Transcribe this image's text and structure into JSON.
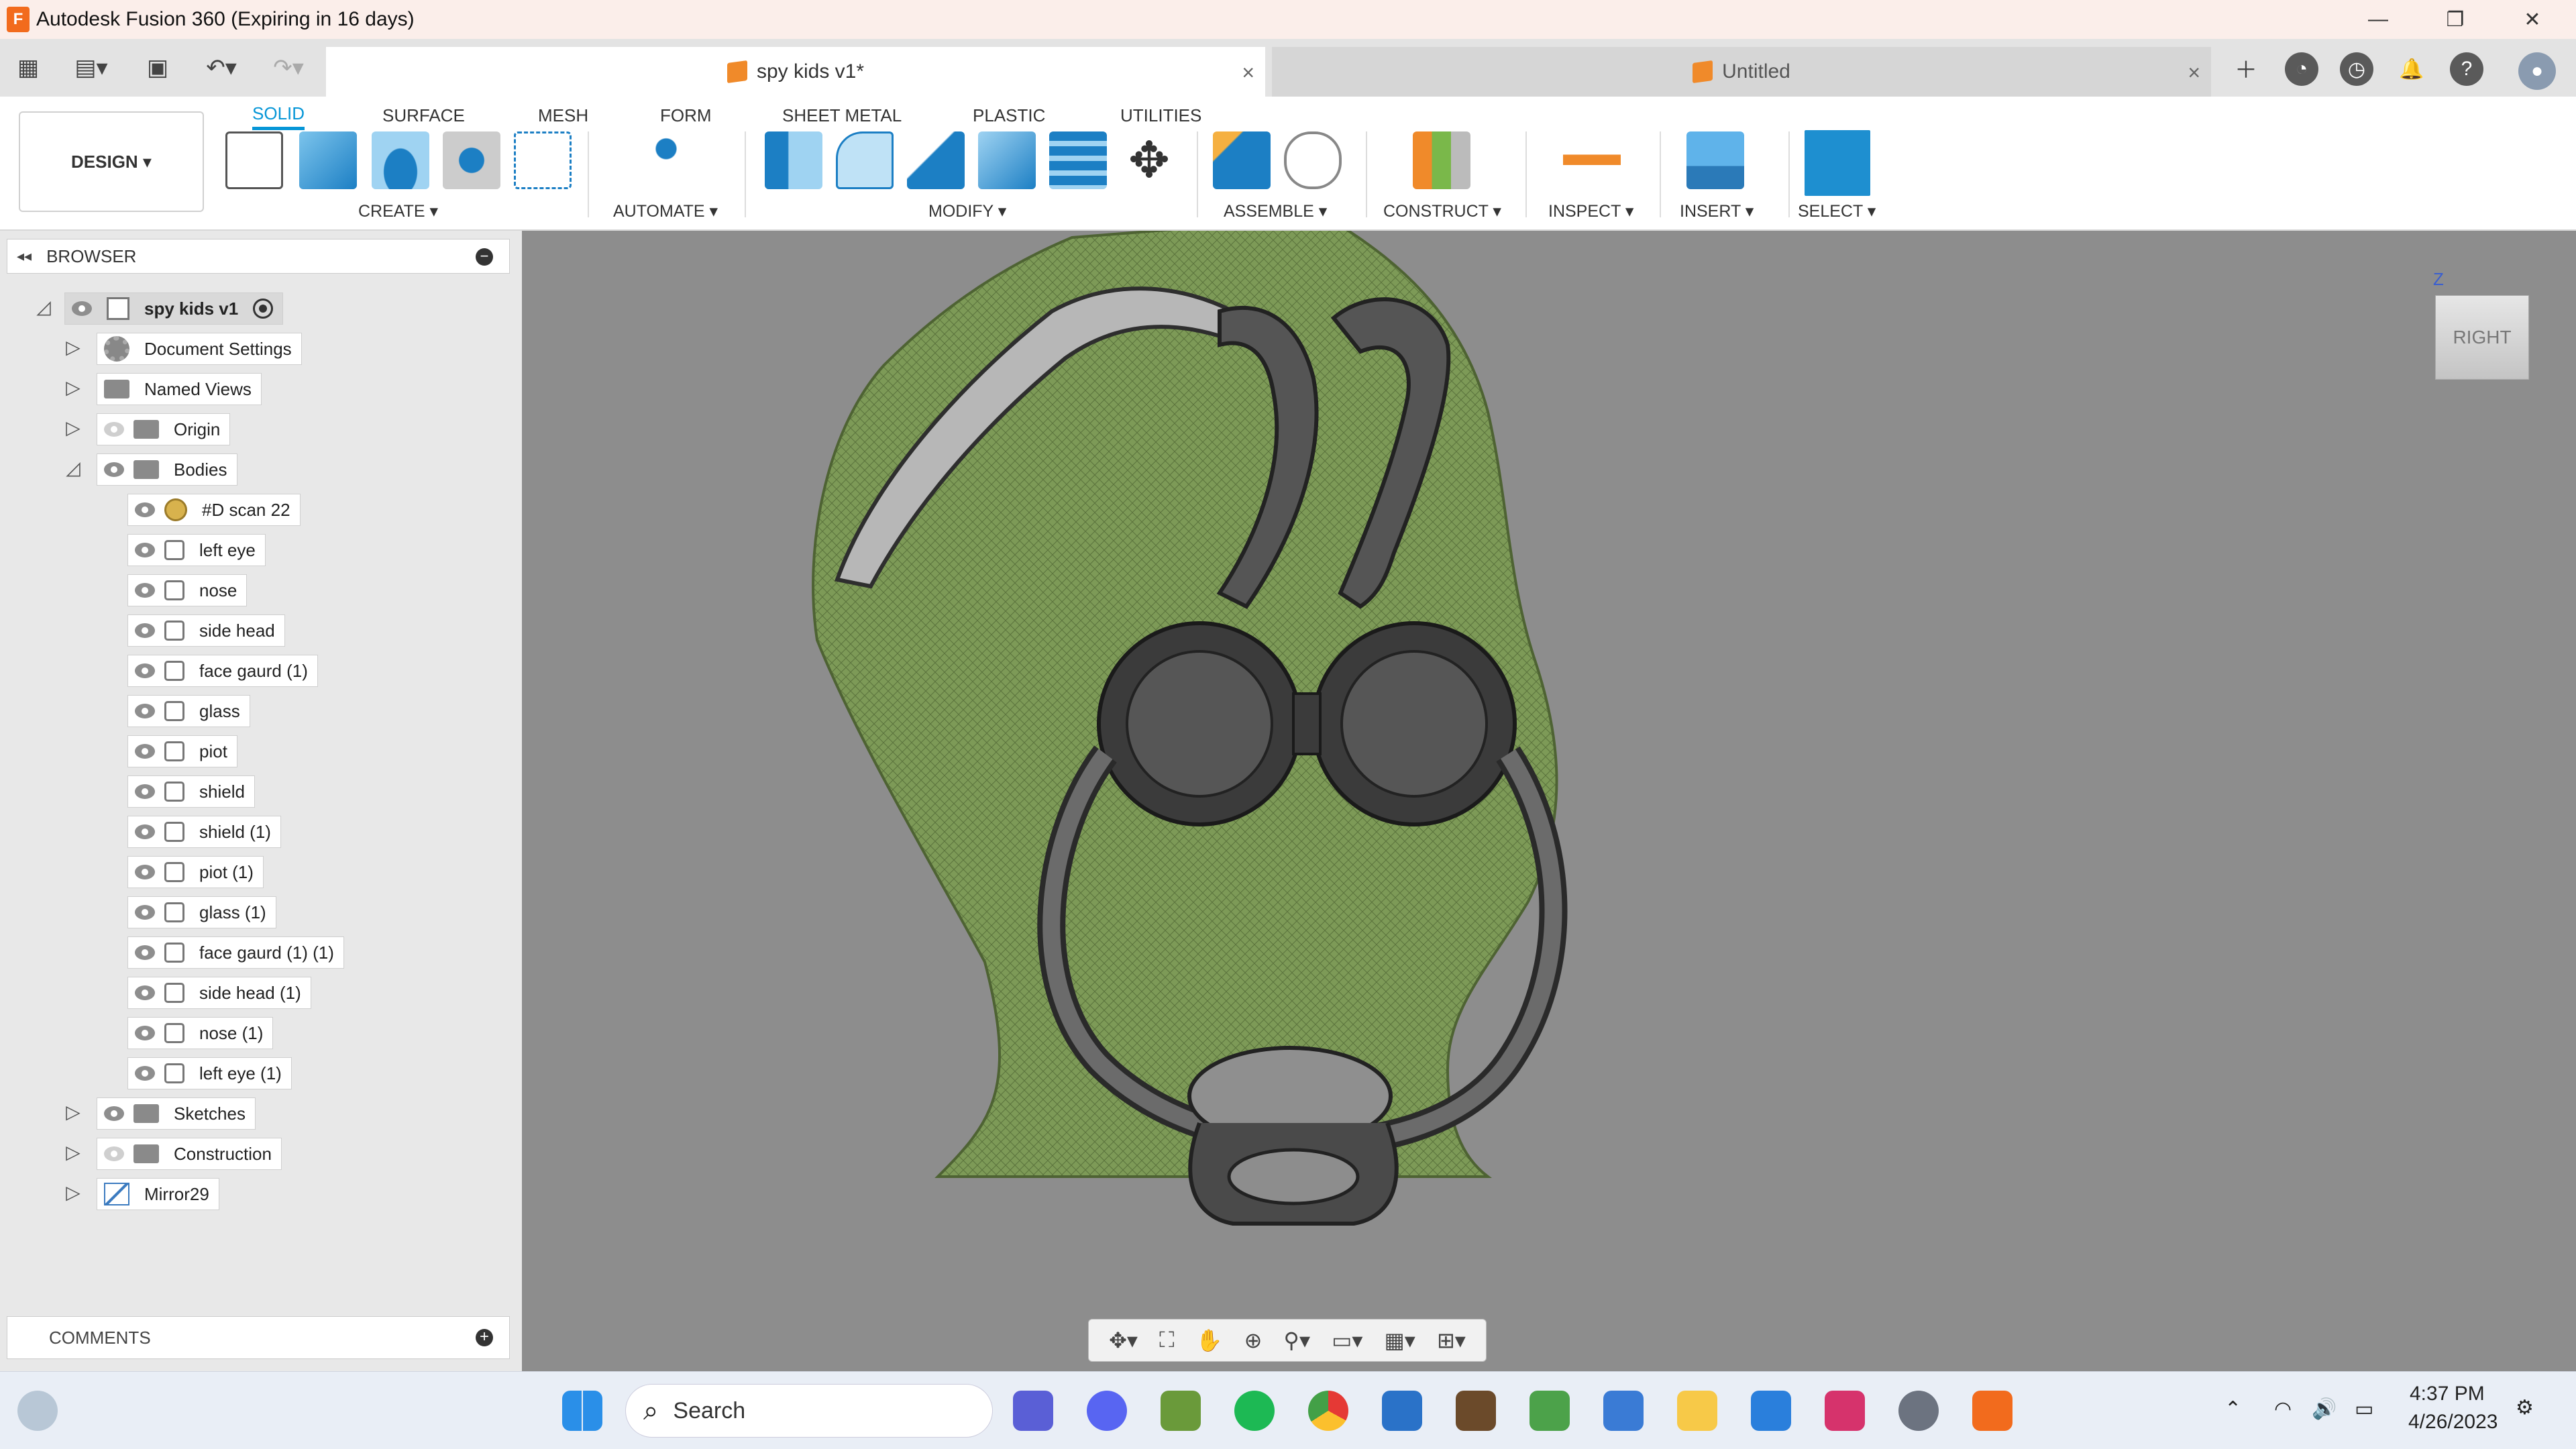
{
  "window": {
    "title": "Autodesk Fusion 360 (Expiring in 16 days)",
    "logo_letter": "F"
  },
  "doc_tabs": [
    {
      "label": "spy kids v1*",
      "close": "×"
    },
    {
      "label": "Untitled",
      "close": "×"
    }
  ],
  "workspace": {
    "label": "DESIGN ▾"
  },
  "ribbon_tabs": [
    "SOLID",
    "SURFACE",
    "MESH",
    "FORM",
    "SHEET METAL",
    "PLASTIC",
    "UTILITIES"
  ],
  "ribbon_groups": [
    "CREATE ▾",
    "AUTOMATE ▾",
    "MODIFY ▾",
    "ASSEMBLE ▾",
    "CONSTRUCT ▾",
    "INSPECT ▾",
    "INSERT ▾",
    "SELECT ▾"
  ],
  "browser": {
    "header": "BROWSER",
    "root": "spy kids v1",
    "top_nodes": [
      "Document Settings",
      "Named Views",
      "Origin",
      "Bodies"
    ],
    "bodies": [
      "#D scan 22",
      "left eye",
      "nose",
      "side head",
      "face gaurd (1)",
      "glass",
      "piot",
      "shield",
      "shield (1)",
      "piot (1)",
      "glass (1)",
      "face gaurd (1) (1)",
      "side head (1)",
      "nose (1)",
      "left eye (1)"
    ],
    "bottom_nodes": [
      "Sketches",
      "Construction",
      "Mirror29"
    ]
  },
  "comments": {
    "label": "COMMENTS"
  },
  "viewcube": {
    "face": "RIGHT",
    "axis": "Z"
  },
  "taskbar": {
    "search_placeholder": "Search",
    "time": "4:37 PM",
    "date": "4/26/2023"
  },
  "colors": {
    "accent": "#0696d7",
    "mesh_green": "#7d9a57",
    "viewport_bg": "#8d8d8d",
    "fusion_orange": "#f26b1d"
  }
}
